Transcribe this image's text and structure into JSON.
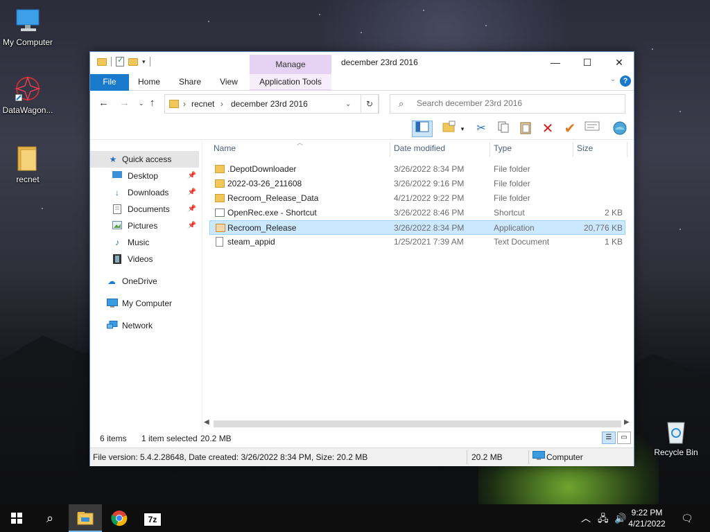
{
  "desktop": {
    "icons": [
      {
        "label": "My Computer"
      },
      {
        "label": "DataWagon..."
      },
      {
        "label": "recnet"
      },
      {
        "label": "Recycle Bin"
      }
    ]
  },
  "window": {
    "title": "december 23rd 2016",
    "context_tab": "Manage",
    "controls": {
      "minimize": "—",
      "maximize": "☐",
      "close": "✕"
    }
  },
  "ribbon": {
    "tabs": {
      "file": "File",
      "home": "Home",
      "share": "Share",
      "view": "View",
      "app_tools": "Application Tools"
    }
  },
  "address": {
    "crumbs": [
      "recnet",
      "december 23rd 2016"
    ],
    "search_placeholder": "Search december 23rd 2016"
  },
  "nav": {
    "quick_access": "Quick access",
    "desktop": "Desktop",
    "downloads": "Downloads",
    "documents": "Documents",
    "pictures": "Pictures",
    "music": "Music",
    "videos": "Videos",
    "onedrive": "OneDrive",
    "my_computer": "My Computer",
    "network": "Network"
  },
  "columns": {
    "name": "Name",
    "date": "Date modified",
    "type": "Type",
    "size": "Size"
  },
  "files": [
    {
      "name": ".DepotDownloader",
      "date": "3/26/2022 8:34 PM",
      "type": "File folder",
      "size": ""
    },
    {
      "name": "2022-03-26_211608",
      "date": "3/26/2022 9:16 PM",
      "type": "File folder",
      "size": ""
    },
    {
      "name": "Recroom_Release_Data",
      "date": "4/21/2022 9:22 PM",
      "type": "File folder",
      "size": ""
    },
    {
      "name": "OpenRec.exe - Shortcut",
      "date": "3/26/2022 8:46 PM",
      "type": "Shortcut",
      "size": "2 KB"
    },
    {
      "name": "Recroom_Release",
      "date": "3/26/2022 8:34 PM",
      "type": "Application",
      "size": "20,776 KB"
    },
    {
      "name": "steam_appid",
      "date": "1/25/2021 7:39 AM",
      "type": "Text Document",
      "size": "1 KB"
    }
  ],
  "status": {
    "count": "6 items",
    "selected": "1 item selected",
    "selected_size": "20.2 MB"
  },
  "details": {
    "info": "File version: 5.4.2.28648, Date created: 3/26/2022 8:34 PM, Size: 20.2 MB",
    "size": "20.2 MB",
    "location": "Computer"
  },
  "taskbar": {
    "time": "9:22 PM",
    "date": "4/21/2022",
    "sevenzip_label": "7z"
  }
}
